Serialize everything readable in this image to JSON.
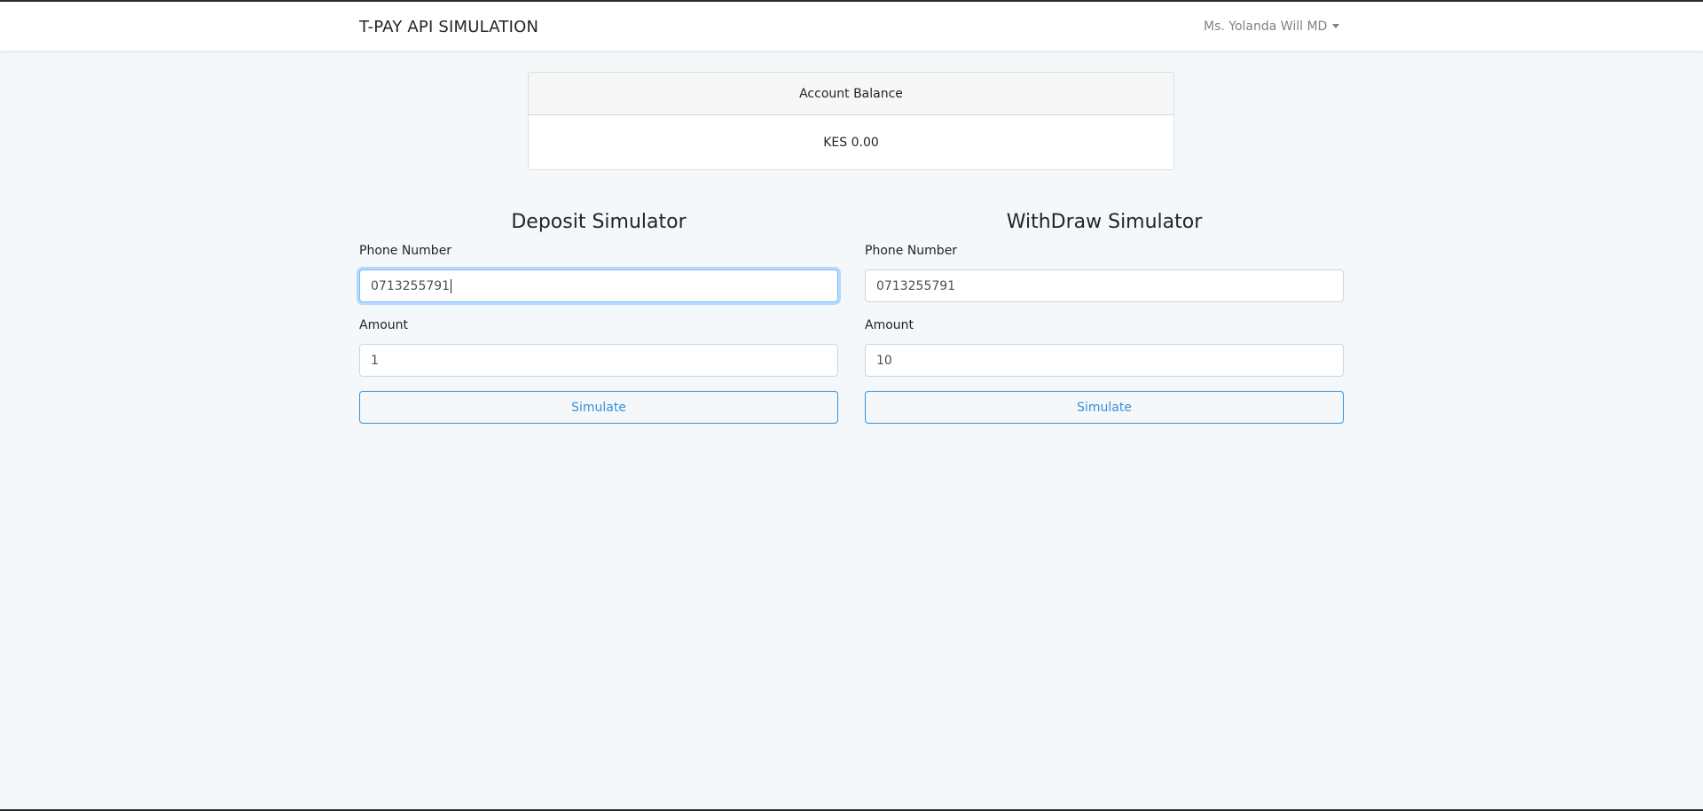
{
  "navbar": {
    "brand": "T-PAY API SIMULATION",
    "user_name": "Ms. Yolanda Will MD"
  },
  "balance": {
    "header": "Account Balance",
    "value": "KES 0.00"
  },
  "deposit": {
    "title": "Deposit Simulator",
    "phone_label": "Phone Number",
    "phone_value": "0713255791",
    "amount_label": "Amount",
    "amount_value": "1",
    "button_label": "Simulate"
  },
  "withdraw": {
    "title": "WithDraw Simulator",
    "phone_label": "Phone Number",
    "phone_value": "0713255791",
    "amount_label": "Amount",
    "amount_value": "10",
    "button_label": "Simulate"
  },
  "colors": {
    "background": "#f5f8fa",
    "primary": "#3490dc",
    "focus_border": "#80bdff"
  },
  "icons": {
    "user_menu": "caret-down-icon"
  }
}
